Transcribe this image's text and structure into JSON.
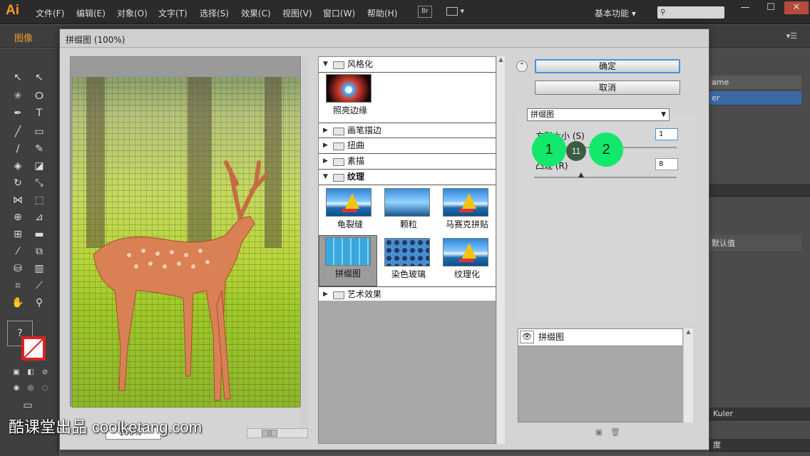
{
  "app": {
    "logo": "Ai",
    "menus": [
      "文件(F)",
      "编辑(E)",
      "对象(O)",
      "文字(T)",
      "选择(S)",
      "效果(C)",
      "视图(V)",
      "窗口(W)",
      "帮助(H)"
    ],
    "bridge_label": "Br",
    "workspace": "基本功能",
    "workspace_arrow": "▾",
    "search_placeholder": "",
    "window_controls": [
      "—",
      "☐",
      "✕"
    ],
    "doc_tab": "图像"
  },
  "tools": {
    "fill_label": "?"
  },
  "right_panel": {
    "rows": [
      "ame",
      "er"
    ],
    "default_label": "默认值",
    "kuler_label": "Kuler",
    "bottom_label": "度"
  },
  "dialog": {
    "title": "拼缀图 (100%)",
    "zoom": "100%",
    "ok": "确定",
    "cancel": "取消",
    "collapse_icon": "⌃",
    "filter_select": "拼缀图",
    "params": [
      {
        "label": "方形大小 (S)",
        "value": "1"
      },
      {
        "label": "凸现 (R)",
        "value": "8"
      }
    ],
    "tree": {
      "categories": [
        {
          "name": "风格化",
          "expanded": true,
          "items": [
            "照亮边缘"
          ]
        },
        {
          "name": "画笔描边",
          "expanded": false
        },
        {
          "name": "扭曲",
          "expanded": false
        },
        {
          "name": "素描",
          "expanded": false
        },
        {
          "name": "纹理",
          "expanded": true,
          "items": [
            "龟裂缝",
            "颗粒",
            "马赛克拼贴",
            "拼缀图",
            "染色玻璃",
            "纹理化"
          ]
        },
        {
          "name": "艺术效果",
          "expanded": false
        }
      ],
      "selected": "拼缀图"
    },
    "layer": "拼缀图"
  },
  "annotations": {
    "bubble_1": "1",
    "bubble_mid": "11",
    "bubble_2": "2"
  },
  "watermark": {
    "brand": "酷课堂出品",
    "domain": "coolketang.com"
  },
  "colors": {
    "accent_orange": "#f39a2b",
    "bubble_green": "#12e86b",
    "selection_blue": "#3c6aa5"
  }
}
